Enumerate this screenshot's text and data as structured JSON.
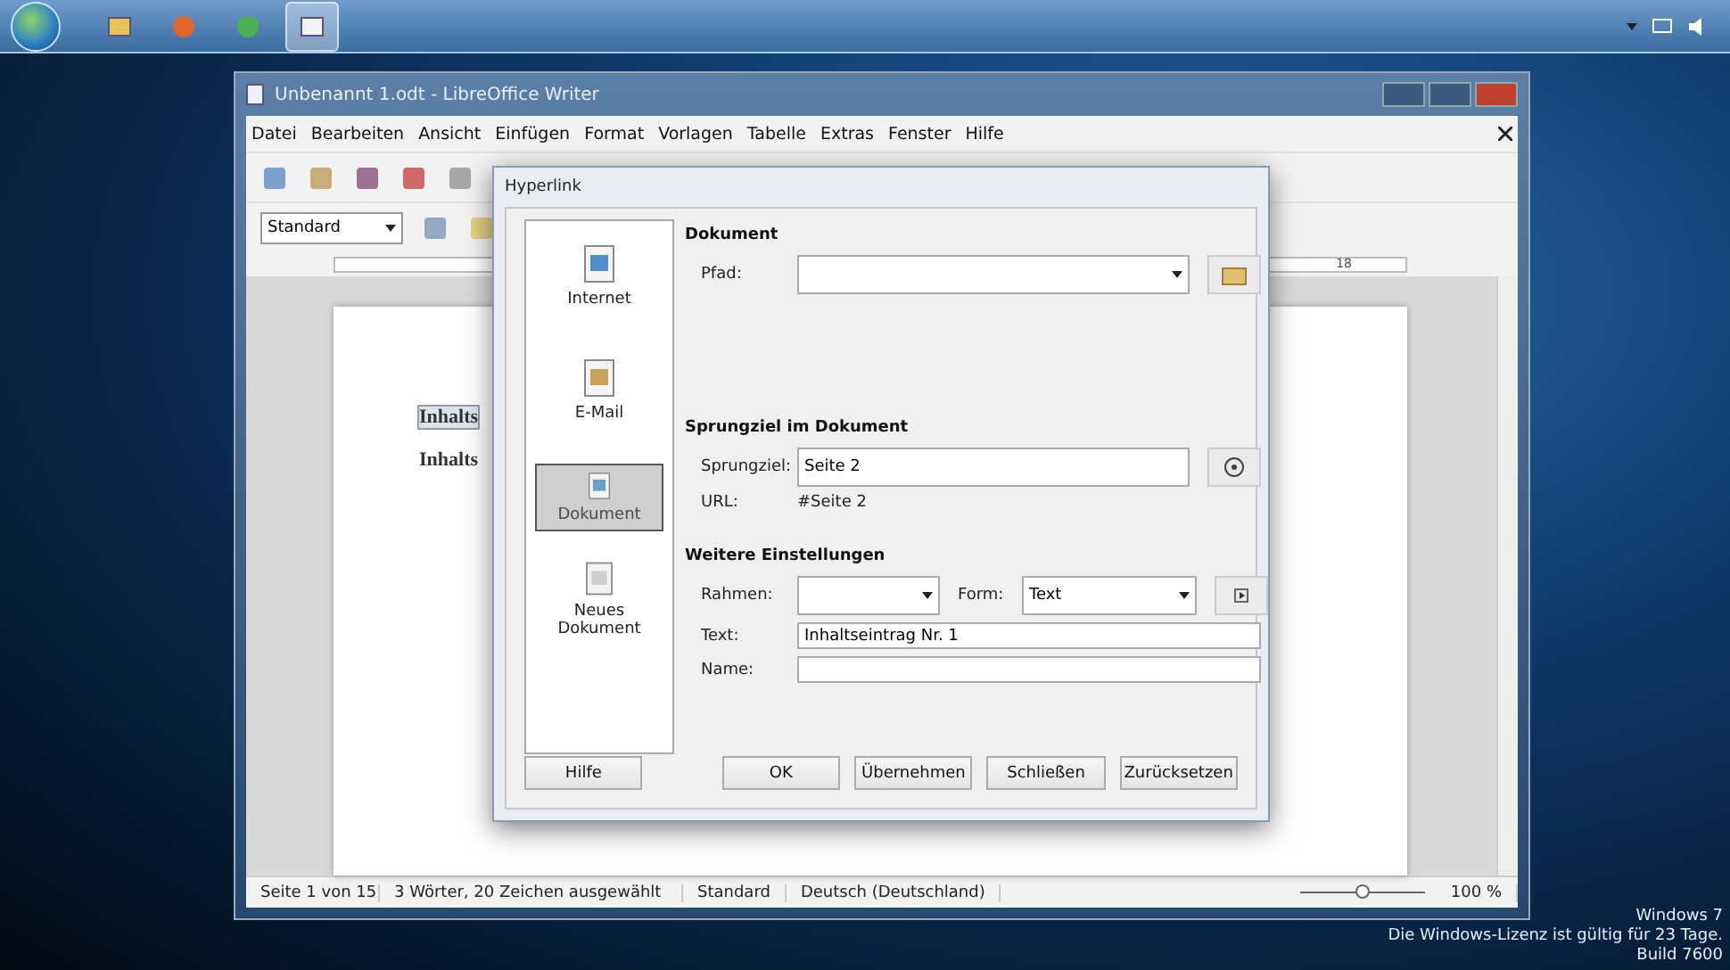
{
  "taskbar": {
    "apps": [
      {
        "kind": "folder",
        "selected": false
      },
      {
        "kind": "firefox",
        "selected": false
      },
      {
        "kind": "chrome",
        "selected": false
      },
      {
        "kind": "writer",
        "selected": true
      }
    ]
  },
  "window": {
    "title": "Unbenannt 1.odt - LibreOffice Writer"
  },
  "menu": [
    "Datei",
    "Bearbeiten",
    "Ansicht",
    "Einfügen",
    "Format",
    "Vorlagen",
    "Tabelle",
    "Extras",
    "Fenster",
    "Hilfe"
  ],
  "formatting_toolbar": {
    "style": "Standard"
  },
  "ruler": {
    "label": "18"
  },
  "document": {
    "lines": [
      {
        "text": "Inhalts",
        "selected": true
      },
      {
        "text": "Inhalts",
        "selected": false
      }
    ]
  },
  "status_bar": {
    "page": "Seite 1 von 15",
    "selection": "3 Wörter, 20 Zeichen ausgewählt",
    "style": "Standard",
    "language": "Deutsch (Deutschland)",
    "zoom": {
      "level": 0.5
    },
    "zoom_reading": "100 %"
  },
  "dialog": {
    "title": "Hyperlink",
    "categories": [
      {
        "label": "Internet",
        "kind": "internet",
        "selected": false
      },
      {
        "label": "E-Mail",
        "kind": "mail",
        "selected": false
      },
      {
        "label": "Dokument",
        "kind": "document",
        "selected": true
      },
      {
        "label": "Neues Dokument",
        "kind": "new",
        "selected": false
      }
    ],
    "document_section": {
      "heading": "Dokument",
      "path_label": "Pfad:"
    },
    "target_section": {
      "heading": "Sprungziel im Dokument",
      "target_label": "Sprungziel:",
      "target_value": "Seite 2",
      "url_label": "URL:",
      "url_value": "#Seite 2"
    },
    "settings_section": {
      "heading": "Weitere Einstellungen",
      "frame_label": "Rahmen:",
      "form_label": "Form:",
      "form_value": "Text",
      "text_label": "Text:",
      "text_value": "Inhaltseintrag Nr. 1",
      "name_label": "Name:"
    },
    "buttons": [
      "Hilfe",
      "OK",
      "Übernehmen",
      "Schließen",
      "Zurücksetzen"
    ]
  },
  "os_notice": [
    "Windows 7",
    "Die Windows-Lizenz ist gültig für 23 Tage.",
    "Build 7600"
  ]
}
